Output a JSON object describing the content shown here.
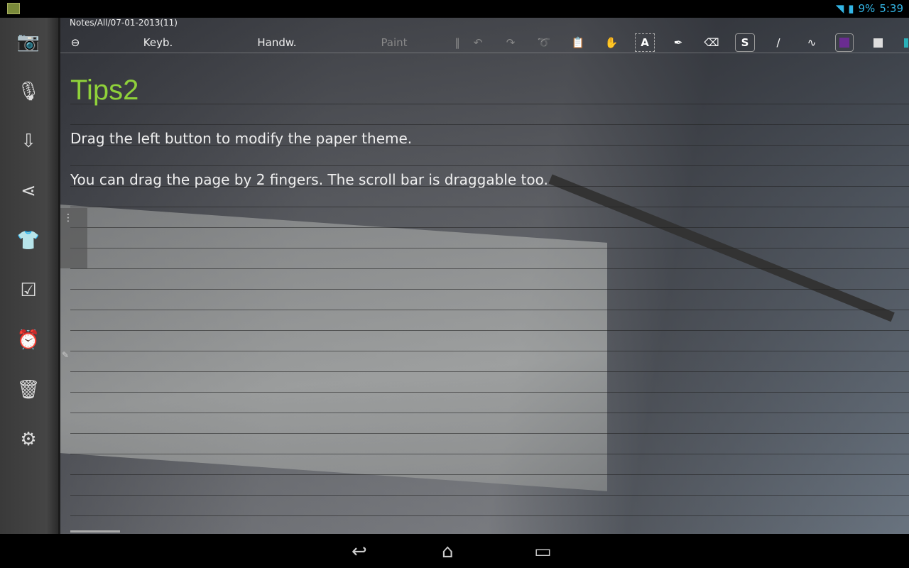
{
  "status": {
    "battery": "9%",
    "time": "5:39",
    "wifi_icon": "wifi-icon",
    "battery_icon": "battery-charging-icon"
  },
  "sidebar": {
    "items": [
      {
        "icon": "camera-icon",
        "glyph": "📷"
      },
      {
        "icon": "microphone-icon",
        "glyph": "🎙"
      },
      {
        "icon": "import-icon",
        "glyph": "⇩"
      },
      {
        "icon": "share-icon",
        "glyph": "⋖"
      },
      {
        "icon": "theme-shirt-icon",
        "glyph": "👕"
      },
      {
        "icon": "checklist-icon",
        "glyph": "☑"
      },
      {
        "icon": "alarm-icon",
        "glyph": "⏰"
      },
      {
        "icon": "trash-icon",
        "glyph": "🗑"
      },
      {
        "icon": "settings-icon",
        "glyph": "⚙"
      }
    ]
  },
  "breadcrumb": "Notes/All/07-01-2013(11)",
  "toolbar": {
    "back": "⊖",
    "keyb": "Keyb.",
    "handw": "Handw.",
    "paint": "Paint",
    "sep": "‖",
    "undo": "↶",
    "redo": "↷",
    "lasso": "➰",
    "paste": "📋",
    "hand": "✋",
    "text": "A",
    "pen": "✒",
    "eraser": "⌫",
    "stroke": "S",
    "brush": "/",
    "scribble": "∿",
    "color_purple": "#6a2c91",
    "color_white": "#dddddd"
  },
  "note": {
    "title": "Tips2",
    "lines": [
      "Drag the left button to modify the paper theme.",
      "You can drag the page by 2 fingers. The scroll bar is draggable too."
    ]
  },
  "handle": {
    "dots": "⋮",
    "pen": "✎"
  },
  "navbar": {
    "back": "↩",
    "home": "⌂",
    "recents": "▭"
  }
}
